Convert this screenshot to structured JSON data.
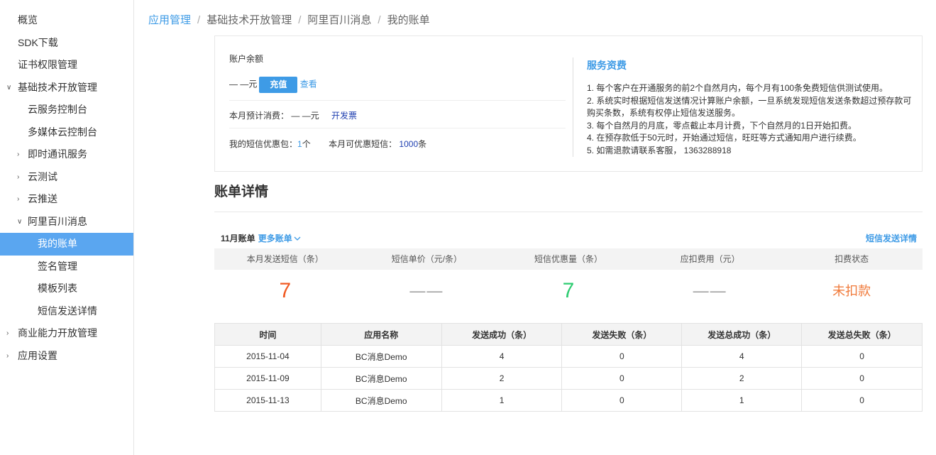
{
  "sidebar": {
    "items": [
      {
        "label": "概览",
        "level": 1,
        "chevron": ""
      },
      {
        "label": "SDK下载",
        "level": 1,
        "chevron": ""
      },
      {
        "label": "证书权限管理",
        "level": 1,
        "chevron": ""
      },
      {
        "label": "基础技术开放管理",
        "level": 1,
        "chevron": "∨"
      },
      {
        "label": "云服务控制台",
        "level": 2,
        "chevron": ""
      },
      {
        "label": "多媒体云控制台",
        "level": 2,
        "chevron": ""
      },
      {
        "label": "即时通讯服务",
        "level": 2,
        "chevron": "›"
      },
      {
        "label": "云测试",
        "level": 2,
        "chevron": "›"
      },
      {
        "label": "云推送",
        "level": 2,
        "chevron": "›"
      },
      {
        "label": "阿里百川消息",
        "level": 2,
        "chevron": "∨"
      },
      {
        "label": "我的账单",
        "level": 3,
        "chevron": "",
        "active": true
      },
      {
        "label": "签名管理",
        "level": 3,
        "chevron": ""
      },
      {
        "label": "模板列表",
        "level": 3,
        "chevron": ""
      },
      {
        "label": "短信发送详情",
        "level": 3,
        "chevron": ""
      },
      {
        "label": "商业能力开放管理",
        "level": 1,
        "chevron": "›"
      },
      {
        "label": "应用设置",
        "level": 1,
        "chevron": "›"
      }
    ]
  },
  "breadcrumb": {
    "items": [
      "应用管理",
      "基础技术开放管理",
      "阿里百川消息",
      "我的账单"
    ],
    "separator": "/"
  },
  "account": {
    "balance_label": "账户余额",
    "balance_value": "— —元",
    "recharge_button": "充值",
    "view_link": "查看",
    "monthly_estimate_label": "本月预计消费：",
    "monthly_estimate_value": "— —元",
    "invoice_link": "开发票",
    "package_label": "我的短信优惠包：",
    "package_count": "1",
    "package_unit": "个",
    "discount_label": "本月可优惠短信：",
    "discount_count": "1000",
    "discount_unit": "条"
  },
  "service_fee": {
    "title": "服务资费",
    "rules": [
      "1. 每个客户在开通服务的前2个自然月内，每个月有100条免费短信供测试使用。",
      "2. 系统实时根据短信发送情况计算账户余额，一旦系统发现短信发送条数超过预存款可购买条数，系统有权停止短信发送服务。",
      "3. 每个自然月的月底，零点截止本月计费，下个自然月的1日开始扣费。",
      "4. 在预存款低于50元时，开始通过短信，旺旺等方式通知用户进行续费。",
      "5. 如需退款请联系客服， 1363288918"
    ]
  },
  "bill": {
    "title": "账单详情",
    "month": "11月账单",
    "more_bills": "更多账单",
    "sms_detail_link": "短信发送详情",
    "stats_headers": [
      "本月发送短信（条）",
      "短信单价（元/条）",
      "短信优惠量（条）",
      "应扣费用（元）",
      "扣费状态"
    ],
    "stats_values": {
      "sent": "7",
      "unit_price": "——",
      "discount": "7",
      "fee": "——",
      "status": "未扣款"
    },
    "colors": {
      "sent": "#f05a23",
      "discount": "#2ecc71",
      "status": "#f07b3c"
    },
    "table_headers": [
      "时间",
      "应用名称",
      "发送成功（条）",
      "发送失败（条）",
      "发送总成功（条）",
      "发送总失败（条）"
    ],
    "rows": [
      [
        "2015-11-04",
        "BC消息Demo",
        "4",
        "0",
        "4",
        "0"
      ],
      [
        "2015-11-09",
        "BC消息Demo",
        "2",
        "0",
        "2",
        "0"
      ],
      [
        "2015-11-13",
        "BC消息Demo",
        "1",
        "0",
        "1",
        "0"
      ]
    ]
  }
}
